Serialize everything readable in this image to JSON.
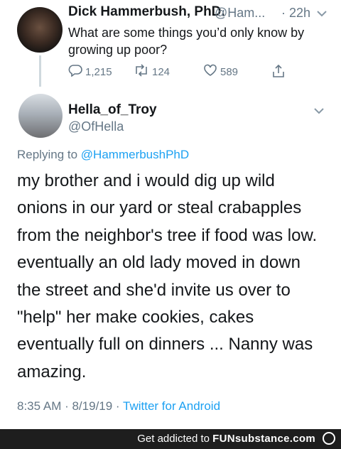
{
  "tweet1": {
    "display_name": "Dick Hammerbush, PhD.",
    "handle": "@Ham...",
    "time": "· 22h",
    "text": "What are some things you’d only know by growing up poor?",
    "replies": "1,215",
    "retweets": "124",
    "likes": "589",
    "icons": [
      "reply-icon",
      "retweet-icon",
      "like-icon",
      "share-icon",
      "chevron-down-icon"
    ]
  },
  "tweet2": {
    "display_name": "Hella_of_Troy",
    "handle": "@OfHella",
    "replying_prefix": "Replying to",
    "replying_to": "@HammerbushPhD",
    "lines": [
      "my brother and i would dig up wild",
      "onions in our yard or steal crabapples",
      "from the neighbor's tree if food was low.",
      "eventually an old lady moved in down",
      "the street and she'd invite us over to",
      "\"help\" her make cookies, cakes",
      "eventually full on dinners ... Nanny was",
      "amazing."
    ],
    "timestamp": "8:35 AM · 8/19/19 ·",
    "source": "Twitter for Android"
  },
  "footer": {
    "prefix": "Get addicted to",
    "brand": "FUNsubstance.com"
  },
  "colors": {
    "text": "#14171a",
    "muted": "#657786",
    "link": "#1da1f2",
    "footer_bg": "#1e1e1e"
  }
}
